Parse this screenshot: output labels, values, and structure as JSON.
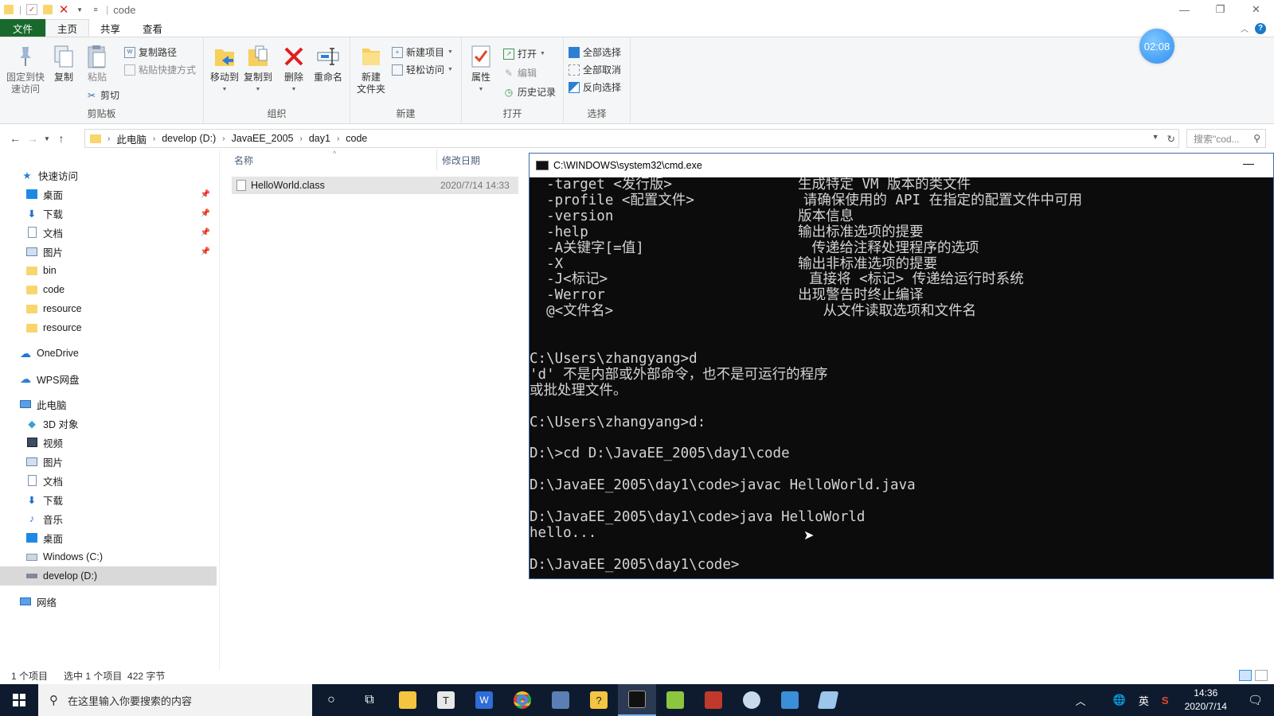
{
  "window": {
    "title": "code"
  },
  "ribbon_tabs": [
    "文件",
    "主页",
    "共享",
    "查看"
  ],
  "ribbon": {
    "clipboard": {
      "label": "剪贴板",
      "pin": "固定到快\n速访问",
      "copy": "复制",
      "paste": "粘贴",
      "copy_path": "复制路径",
      "paste_shortcut": "粘贴快捷方式",
      "cut": "剪切"
    },
    "organize": {
      "label": "组织",
      "move_to": "移动到",
      "copy_to": "复制到",
      "delete": "删除",
      "rename": "重命名"
    },
    "new": {
      "label": "新建",
      "new_folder": "新建\n文件夹",
      "new_item": "新建项目",
      "easy_access": "轻松访问"
    },
    "open": {
      "label": "打开",
      "properties": "属性",
      "open": "打开",
      "edit": "编辑",
      "history": "历史记录"
    },
    "select": {
      "label": "选择",
      "select_all": "全部选择",
      "select_none": "全部取消",
      "invert": "反向选择"
    }
  },
  "timer": "02:08",
  "breadcrumbs": [
    "此电脑",
    "develop (D:)",
    "JavaEE_2005",
    "day1",
    "code"
  ],
  "search_placeholder": "搜索\"cod...",
  "nav": {
    "quick_access": "快速访问",
    "quick_items": [
      {
        "label": "桌面",
        "pinned": true
      },
      {
        "label": "下载",
        "pinned": true
      },
      {
        "label": "文档",
        "pinned": true
      },
      {
        "label": "图片",
        "pinned": true
      },
      {
        "label": "bin",
        "pinned": false
      },
      {
        "label": "code",
        "pinned": false
      },
      {
        "label": "resource",
        "pinned": false
      },
      {
        "label": "resource",
        "pinned": false
      }
    ],
    "onedrive": "OneDrive",
    "wps": "WPS网盘",
    "this_pc": "此电脑",
    "pc_items": [
      "3D 对象",
      "视频",
      "图片",
      "文档",
      "下载",
      "音乐",
      "桌面",
      "Windows (C:)",
      "develop (D:)"
    ],
    "network": "网络"
  },
  "columns": {
    "name": "名称",
    "modified": "修改日期"
  },
  "files": [
    {
      "name": "HelloWorld.class",
      "modified": "2020/7/14 14:33"
    }
  ],
  "status": {
    "count": "1 个项目",
    "selected": "选中 1 个项目  422 字节"
  },
  "cmd": {
    "title": "C:\\WINDOWS\\system32\\cmd.exe",
    "output": "  -target <发行版>               生成特定 VM 版本的类文件\n  -profile <配置文件>             请确保使用的 API 在指定的配置文件中可用\n  -version                      版本信息\n  -help                         输出标准选项的提要\n  -A关键字[=值]                    传递给注释处理程序的选项\n  -X                            输出非标准选项的提要\n  -J<标记>                        直接将 <标记> 传递给运行时系统\n  -Werror                       出现警告时终止编译\n  @<文件名>                         从文件读取选项和文件名\n\n\nC:\\Users\\zhangyang>d\n'd' 不是内部或外部命令，也不是可运行的程序\n或批处理文件。\n\nC:\\Users\\zhangyang>d:\n\nD:\\>cd D:\\JavaEE_2005\\day1\\code\n\nD:\\JavaEE_2005\\day1\\code>javac HelloWorld.java\n\nD:\\JavaEE_2005\\day1\\code>java HelloWorld\nhello...\n\nD:\\JavaEE_2005\\day1\\code>"
  },
  "taskbar": {
    "search_placeholder": "在这里输入你要搜索的内容",
    "ime": "英",
    "time": "14:36",
    "date": "2020/7/14"
  },
  "colors": {
    "file_tab": "#19692c",
    "taskbar": "#0e1b2e",
    "cmd_bg": "#0c0c0c",
    "accent": "#1979ca"
  }
}
